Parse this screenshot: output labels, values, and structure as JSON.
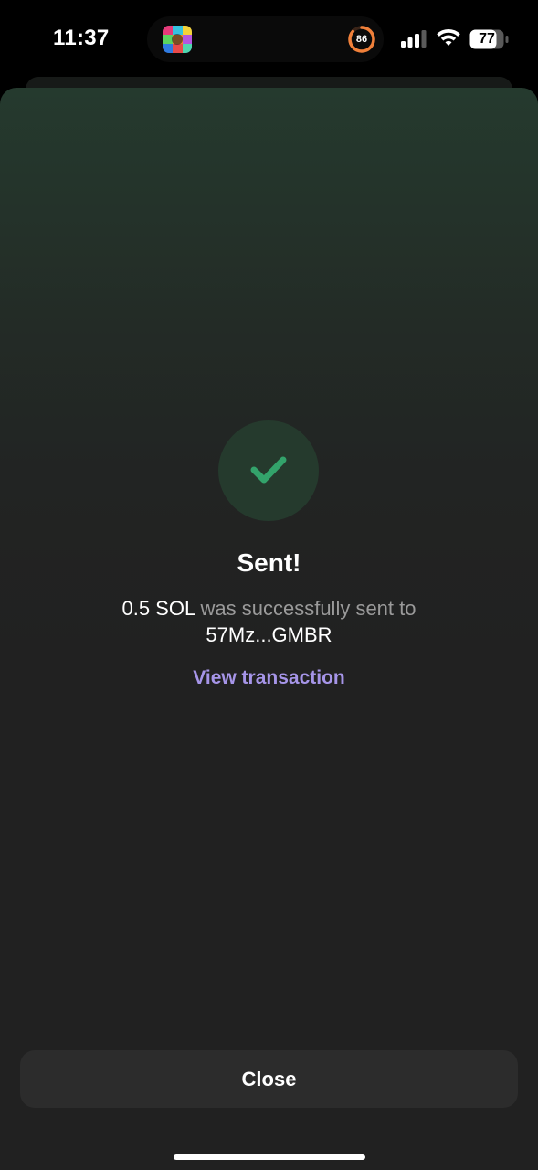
{
  "status_bar": {
    "time": "11:37",
    "ring_value": "86",
    "battery_level": "77",
    "icons": [
      "app-thumbnail-icon",
      "activity-ring-icon",
      "cellular-signal-icon",
      "wifi-icon",
      "battery-icon"
    ]
  },
  "result": {
    "title": "Sent!",
    "amount": "0.5 SOL",
    "message_middle": " was successfully sent to",
    "recipient": "57Mz...GMBR",
    "view_link_label": "View transaction",
    "icon": "checkmark-icon"
  },
  "footer": {
    "close_label": "Close"
  },
  "colors": {
    "accent_green": "#33a36b",
    "link_purple": "#a695e8",
    "sheet_background": "#212121",
    "button_background": "#2c2c2c"
  }
}
